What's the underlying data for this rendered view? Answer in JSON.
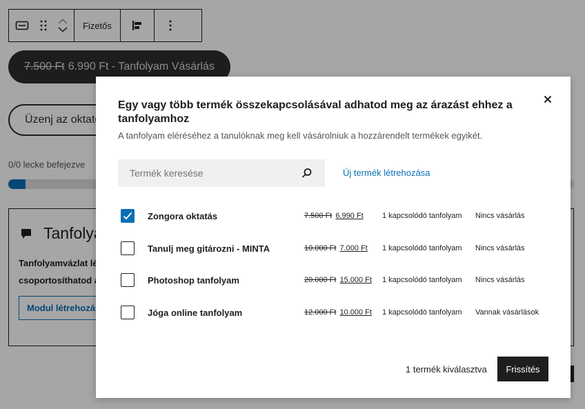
{
  "toolbar": {
    "button_text": "Fizetős"
  },
  "editor": {
    "buy_button": {
      "old_price": "7.500 Ft",
      "label": "6.990 Ft - Tanfolyam Vásárlás"
    },
    "message_button": "Üzenj az oktatónak",
    "progress": {
      "label": "0/0 lecke befejezve",
      "percent": 3
    },
    "outline": {
      "heading": "Tanfolyamvázlat",
      "description": "Tanfolyamvázlat létrehozásával csoportosíthatod a leckéket.",
      "module_button": "Modul létrehozása"
    }
  },
  "modal": {
    "title": "Egy vagy több termék összekapcsolásával adhatod meg az árazást ehhez a tanfolyamhoz",
    "subtitle": "A tanfolyam eléréséhez a tanulóknak meg kell vásárolniuk a hozzárendelt termékek egyikét.",
    "search_placeholder": "Termék keresése",
    "new_product_link": "Új termék létrehozása",
    "products": [
      {
        "name": "Zongora oktatás",
        "old_price": "7.500 Ft",
        "price": "6.990 Ft",
        "courses": "1 kapcsolódó tanfolyam",
        "status": "Nincs vásárlás",
        "checked": true
      },
      {
        "name": "Tanulj meg gitározni - MINTA",
        "old_price": "10.000 Ft",
        "price": "7.000 Ft",
        "courses": "1 kapcsolódó tanfolyam",
        "status": "Nincs vásárlás",
        "checked": false
      },
      {
        "name": "Photoshop tanfolyam",
        "old_price": "20.000 Ft",
        "price": "15.000 Ft",
        "courses": "1 kapcsolódó tanfolyam",
        "status": "Nincs vásárlás",
        "checked": false
      },
      {
        "name": "Jóga online tanfolyam",
        "old_price": "12.000 Ft",
        "price": "10.000 Ft",
        "courses": "1 kapcsolódó tanfolyam",
        "status": "Vannak vásárlások",
        "checked": false
      }
    ],
    "selected_count": "1 termék kiválasztva",
    "update_button": "Frissítés"
  },
  "colors": {
    "accent": "#0a6fb4",
    "dark": "#1e1e1e"
  },
  "icons": [
    "block-type-icon",
    "drag-handle-icon",
    "chevron-up-icon",
    "chevron-down-icon",
    "align-icon",
    "more-options-icon",
    "outline-icon",
    "close-icon",
    "search-icon",
    "checkmark-icon"
  ]
}
